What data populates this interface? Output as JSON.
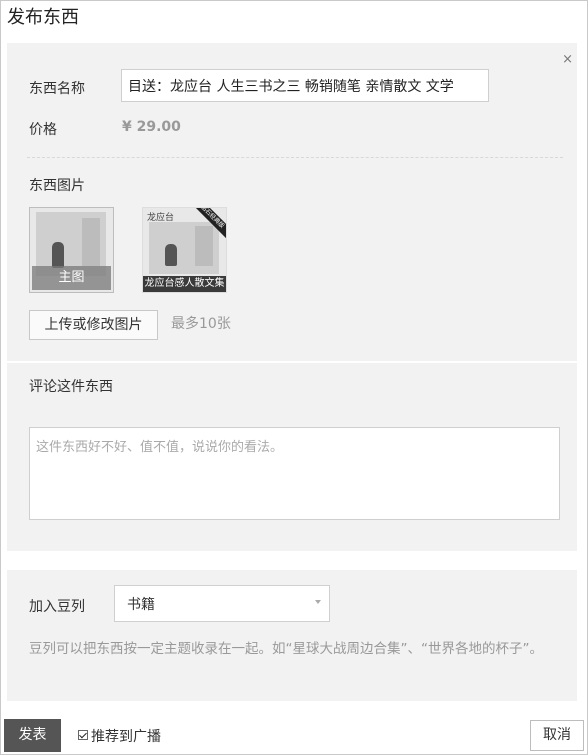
{
  "dialog": {
    "title": "发布东西",
    "close_icon": "×"
  },
  "item": {
    "name_label": "东西名称",
    "name_value": "目送：龙应台 人生三书之三 畅销随笔 亲情散文 文学",
    "price_label": "价格",
    "price_value": "¥ 29.00"
  },
  "images": {
    "section_label": "东西图片",
    "main_overlay": "主图",
    "thumb2_top": "龙应台",
    "thumb2_banner": "龙应台感人散文集",
    "thumb2_ribbon": "钻石经典版",
    "upload_button": "上传或修改图片",
    "max_hint": "最多10张"
  },
  "comment": {
    "section_label": "评论这件东西",
    "placeholder": "这件东西好不好、值不值，说说你的看法。"
  },
  "doulist": {
    "label": "加入豆列",
    "selected": "书籍",
    "help": "豆列可以把东西按一定主题收录在一起。如“星球大战周边合集”、“世界各地的杯子”。"
  },
  "footer": {
    "publish_button": "发表",
    "recommend_label": "推荐到广播",
    "recommend_checked": true,
    "cancel_button": "取消"
  }
}
